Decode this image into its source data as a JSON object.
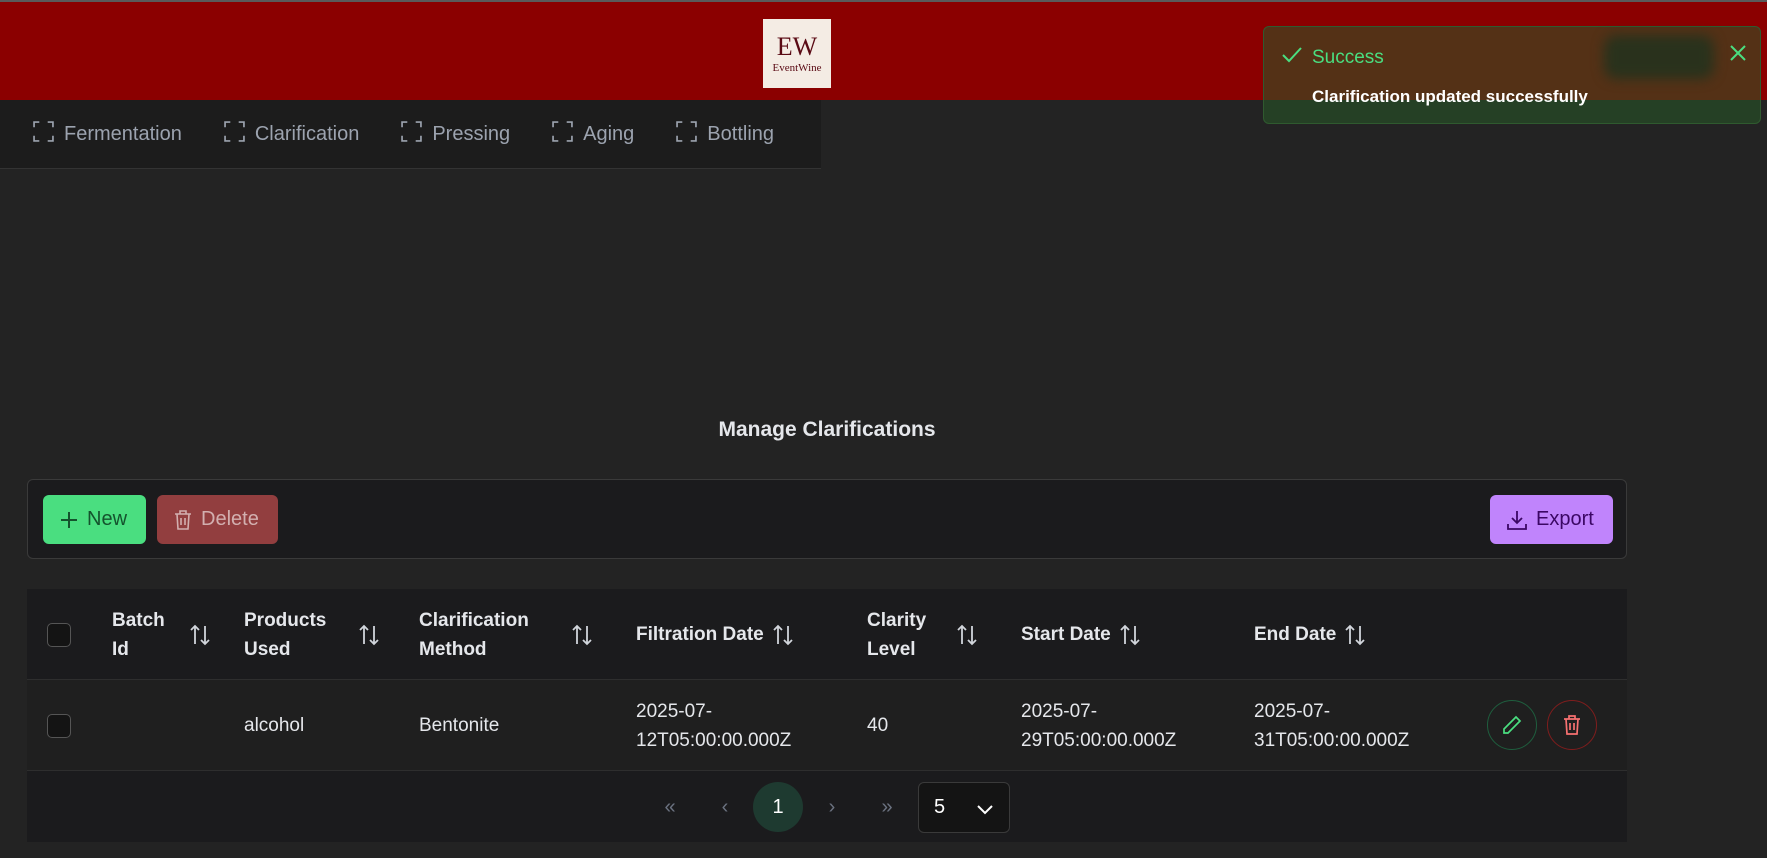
{
  "header": {
    "logo": {
      "mark": "EW",
      "text": "EventWine"
    }
  },
  "tabs": [
    {
      "label": "Fermentation"
    },
    {
      "label": "Clarification"
    },
    {
      "label": "Pressing"
    },
    {
      "label": "Aging"
    },
    {
      "label": "Bottling"
    }
  ],
  "toast": {
    "title": "Success",
    "message": "Clarification updated successfully",
    "color": "#4ade80"
  },
  "page": {
    "title": "Manage Clarifications"
  },
  "toolbar": {
    "new_label": "New",
    "delete_label": "Delete",
    "export_label": "Export"
  },
  "table": {
    "columns": [
      {
        "line1": "Batch",
        "line2": "Id"
      },
      {
        "line1": "Products",
        "line2": "Used"
      },
      {
        "line1": "Clarification",
        "line2": "Method"
      },
      {
        "line1": "Filtration Date",
        "line2": ""
      },
      {
        "line1": "Clarity",
        "line2": "Level"
      },
      {
        "line1": "Start Date",
        "line2": ""
      },
      {
        "line1": "End Date",
        "line2": ""
      }
    ],
    "rows": [
      {
        "batch_id": "",
        "products_used": "alcohol",
        "clarification_method": "Bentonite",
        "filtration_date_1": "2025-07-",
        "filtration_date_2": "12T05:00:00.000Z",
        "clarity_level": "40",
        "start_date_1": "2025-07-",
        "start_date_2": "29T05:00:00.000Z",
        "end_date_1": "2025-07-",
        "end_date_2": "31T05:00:00.000Z"
      }
    ]
  },
  "pagination": {
    "first": "«",
    "prev": "‹",
    "current_page": "1",
    "next": "›",
    "last": "»",
    "rows_per_page": "5"
  },
  "colors": {
    "header_bg": "#8b0000",
    "new_button": "#4ade80",
    "delete_button": "#a74545",
    "export_button": "#c084fc"
  }
}
